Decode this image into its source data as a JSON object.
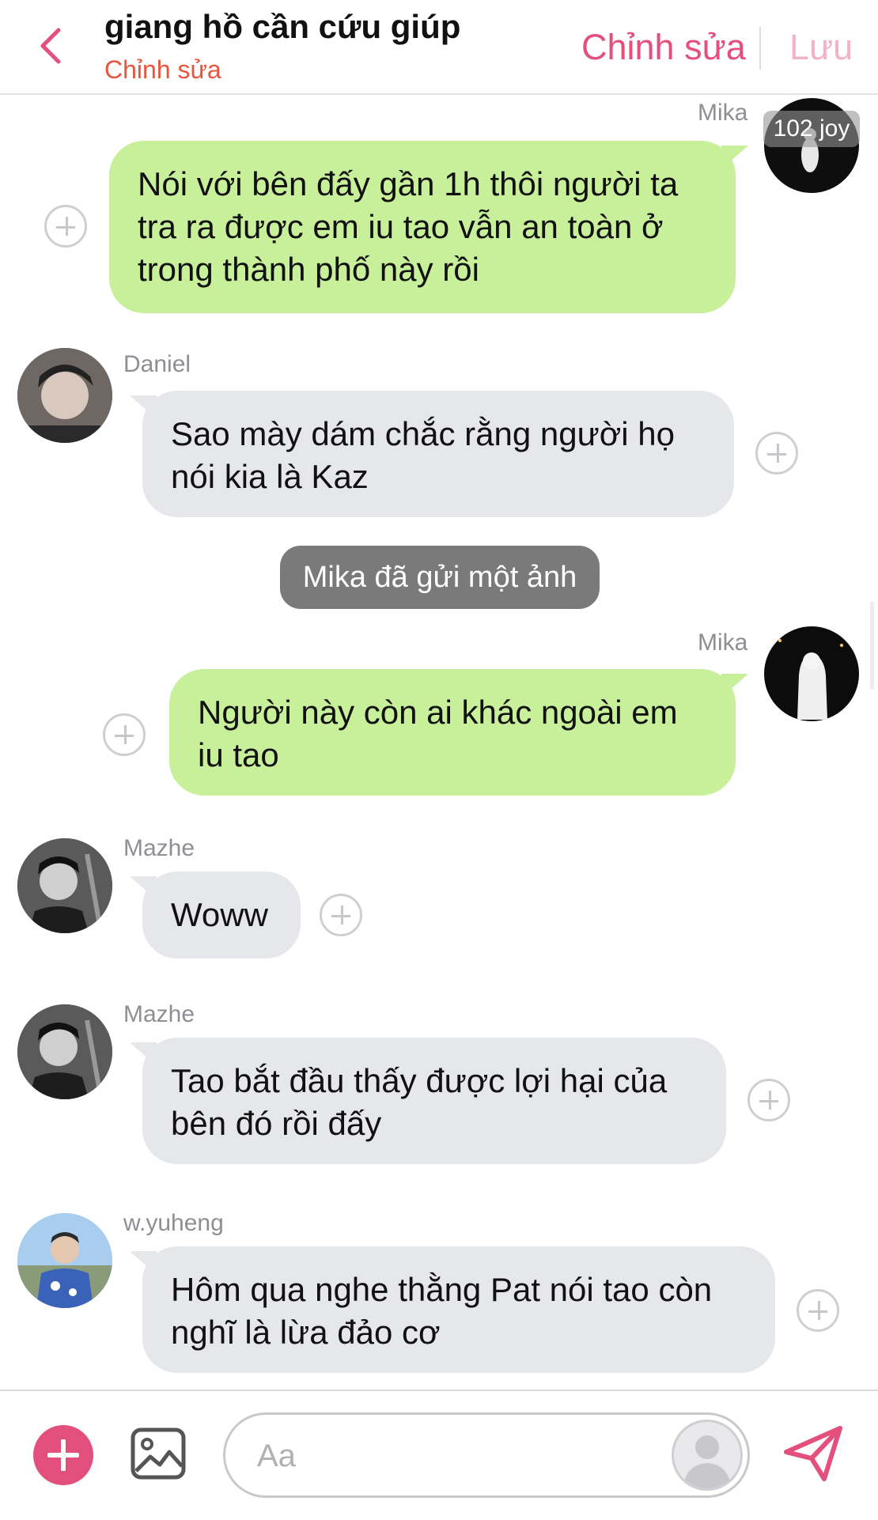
{
  "header": {
    "title": "giang hồ cần cứu giúp",
    "subtitle": "Chỉnh sửa",
    "edit_label": "Chỉnh sửa",
    "save_label": "Lưu"
  },
  "messages": [
    {
      "sender": "Mika",
      "text": "Nói với bên đấy gần 1h thôi người ta tra ra được em iu tao vẫn an toàn ở trong thành phố này rồi",
      "badge": "102 joy"
    },
    {
      "sender": "Daniel",
      "text": "Sao mày dám chắc rằng người họ nói kia là Kaz"
    },
    {
      "notice": "Mika đã gửi một ảnh"
    },
    {
      "sender": "Mika",
      "text": "Người này còn ai khác ngoài em iu tao"
    },
    {
      "sender": "Mazhe",
      "text": "Woww"
    },
    {
      "sender": "Mazhe",
      "text": "Tao bắt đầu thấy được lợi hại của bên đó rồi đấy"
    },
    {
      "sender": "w.yuheng",
      "text": "Hôm qua nghe thằng Pat nói tao còn nghĩ là lừa đảo cơ"
    }
  ],
  "composer": {
    "placeholder": "Aa"
  },
  "colors": {
    "accent": "#e3507e",
    "outgoing_bubble": "#c8ef9a",
    "incoming_bubble": "#e6e7ea",
    "subtitle": "#e8553d",
    "notice_bg": "#7a7a7a"
  },
  "icons": [
    "back-chevron-icon",
    "add-icon",
    "image-icon",
    "avatar-placeholder-icon",
    "send-icon"
  ]
}
